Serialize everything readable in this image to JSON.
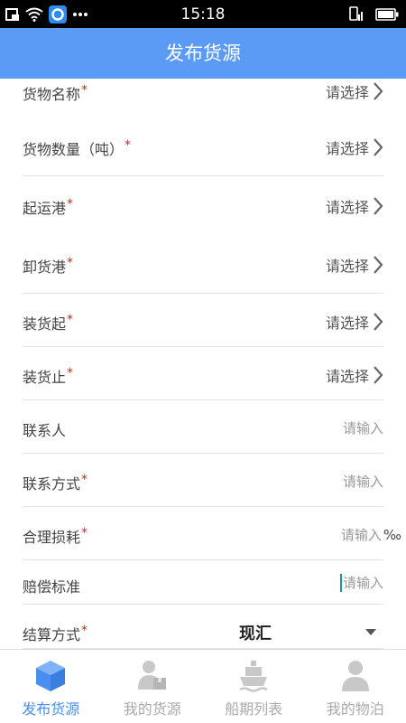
{
  "status_bar": {
    "time": "15:18"
  },
  "header": {
    "title": "发布货源"
  },
  "form": {
    "fields": [
      {
        "label": "货物名称",
        "required": "*",
        "value": "请选择"
      },
      {
        "label": "货物数量（吨）",
        "required": "*",
        "value": "请选择"
      },
      {
        "label": "起运港",
        "required": "*",
        "value": "请选择"
      },
      {
        "label": "卸货港",
        "required": "*",
        "value": "请选择"
      },
      {
        "label": "装货起",
        "required": "*",
        "value": "请选择"
      },
      {
        "label": "装货止",
        "required": "*",
        "value": "请选择"
      },
      {
        "label": "联系人",
        "placeholder": "请输入"
      },
      {
        "label": "联系方式",
        "required": "*",
        "placeholder": "请输入"
      },
      {
        "label": "合理损耗",
        "required": "*",
        "placeholder": "请输入",
        "unit": "‰"
      },
      {
        "label": "赔偿标准",
        "placeholder": "请输入"
      },
      {
        "label": "结算方式",
        "required": "*",
        "selected": "现汇"
      }
    ]
  },
  "bottom_nav": {
    "items": [
      {
        "label": "发布货源",
        "icon": "cube-icon",
        "active": true
      },
      {
        "label": "我的货源",
        "icon": "person-box-icon"
      },
      {
        "label": "船期列表",
        "icon": "ship-icon"
      },
      {
        "label": "我的物泊",
        "icon": "user-icon"
      }
    ],
    "active_color": "#4a8ff0",
    "inactive_color": "#aaaaaa"
  },
  "colors": {
    "header_bg": "#5b9bf5",
    "required": "#e02020"
  }
}
